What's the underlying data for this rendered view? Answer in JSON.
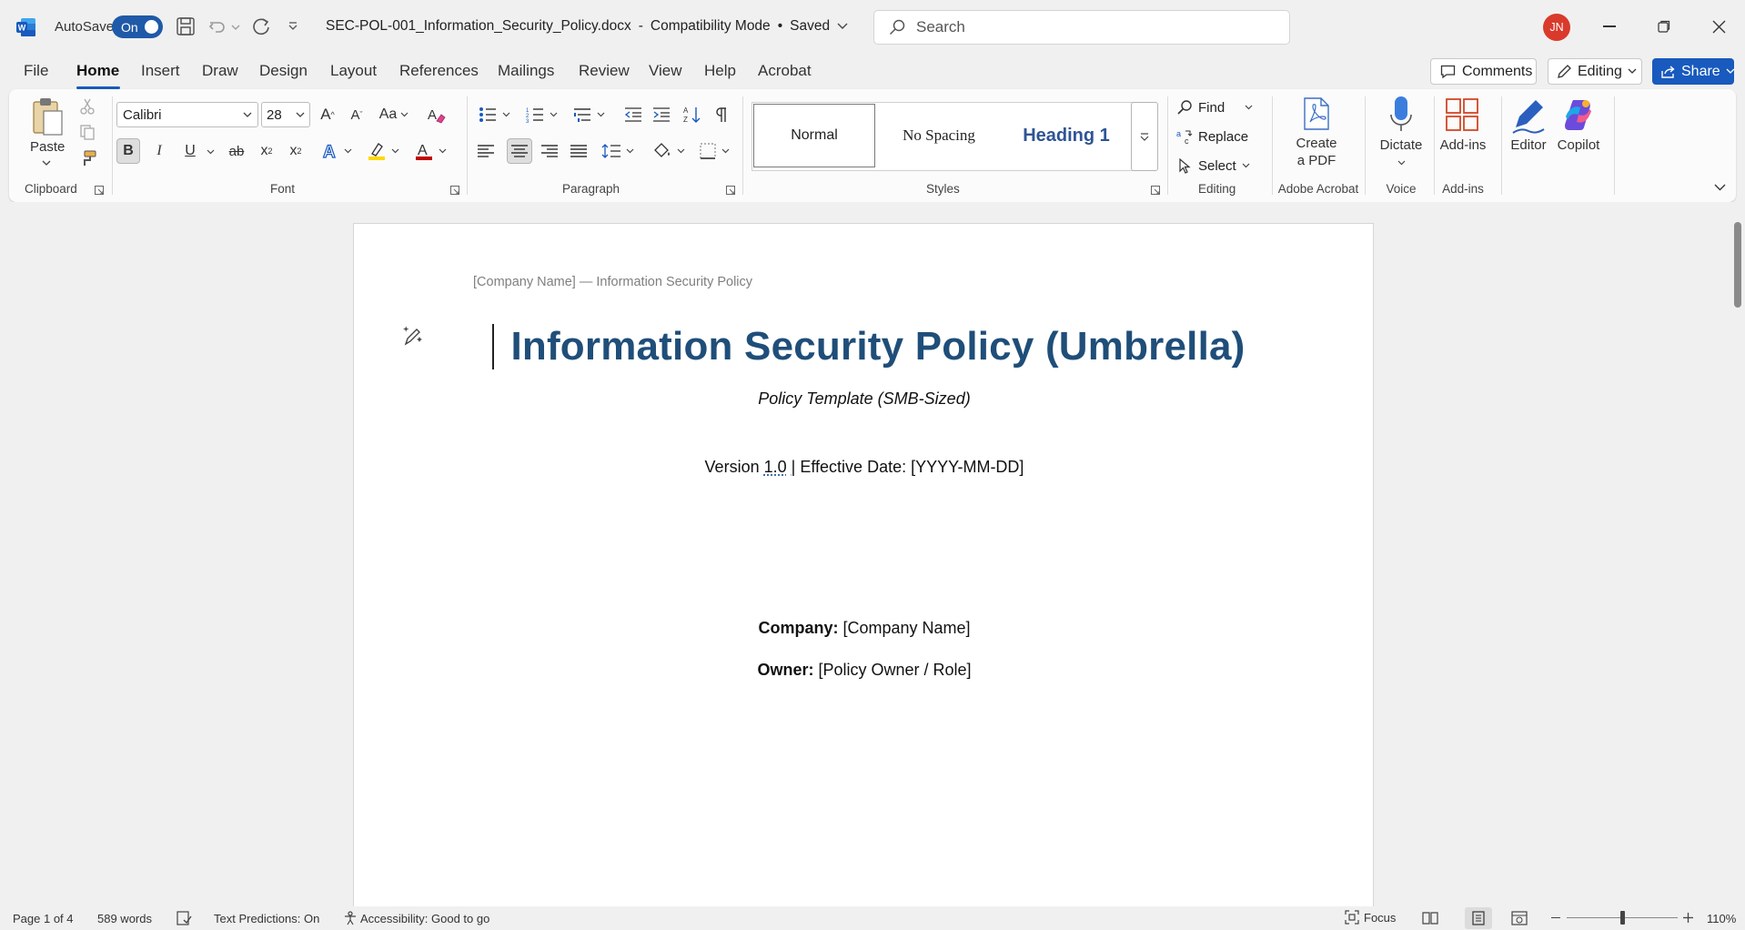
{
  "titlebar": {
    "autosave_label": "AutoSave",
    "autosave_state": "On",
    "filename": "SEC-POL-001_Information_Security_Policy.docx",
    "mode": "Compatibility Mode",
    "save_state": "Saved",
    "search_placeholder": "Search",
    "user_initials": "JN"
  },
  "menu": [
    "File",
    "Home",
    "Insert",
    "Draw",
    "Design",
    "Layout",
    "References",
    "Mailings",
    "Review",
    "View",
    "Help",
    "Acrobat"
  ],
  "menu_active": "Home",
  "top_right": {
    "comments": "Comments",
    "editing": "Editing",
    "share": "Share"
  },
  "ribbon": {
    "clipboard": {
      "paste": "Paste",
      "label": "Clipboard"
    },
    "font": {
      "name": "Calibri",
      "size": "28",
      "label": "Font"
    },
    "paragraph": {
      "label": "Paragraph"
    },
    "styles": {
      "items": [
        "Normal",
        "No Spacing",
        "Heading 1"
      ],
      "label": "Styles"
    },
    "editing": {
      "find": "Find",
      "replace": "Replace",
      "select": "Select",
      "label": "Editing"
    },
    "acrobat": {
      "create_line1": "Create",
      "create_line2": "a PDF",
      "label": "Adobe Acrobat"
    },
    "voice": {
      "dictate": "Dictate",
      "label": "Voice"
    },
    "addins": {
      "addins": "Add-ins",
      "label": "Add-ins"
    },
    "editor": "Editor",
    "copilot": "Copilot",
    "letters": {
      "bold": "B",
      "italic": "I",
      "underline": "U",
      "strike": "ab",
      "sub": "x",
      "sup": "x",
      "sub_idx": "2",
      "sup_idx": "2",
      "case": "Aa",
      "grow": "A",
      "shrink": "A"
    }
  },
  "document": {
    "header": "[Company Name] — Information Security Policy",
    "title": "Information Security Policy (Umbrella)",
    "subtitle": "Policy Template (SMB-Sized)",
    "version_label": "Version",
    "version_value": "1.0",
    "version_sep": "|",
    "effective": "Effective Date: [YYYY-MM-DD]",
    "company_label": "Company:",
    "company_value": "[Company Name]",
    "owner_label": "Owner:",
    "owner_value": "[Policy Owner / Role]"
  },
  "status": {
    "page": "Page 1 of 4",
    "words": "589 words",
    "predictions": "Text Predictions: On",
    "accessibility": "Accessibility: Good to go",
    "focus": "Focus",
    "zoom": "110%"
  },
  "colors": {
    "accent": "#185abd",
    "heading": "#1f4e79",
    "word_blue": "#2b579a",
    "font_red": "#c00000",
    "highlight": "#ffd800"
  }
}
